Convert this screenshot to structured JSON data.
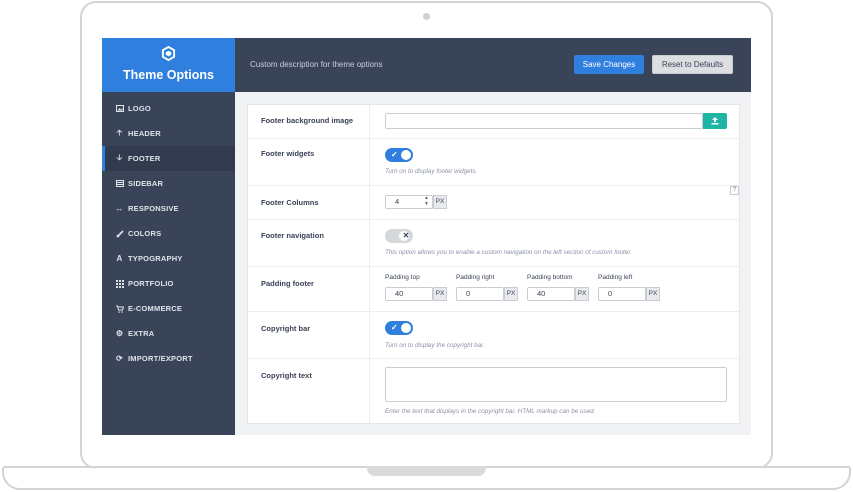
{
  "app": {
    "title": "Theme Options",
    "icon": "hexagon-logo-icon",
    "description": "Custom description for theme options"
  },
  "actions": {
    "save_label": "Save Changes",
    "reset_label": "Reset to Defaults"
  },
  "sidebar": {
    "active": "FOOTER",
    "items": [
      {
        "label": "LOGO",
        "icon": "image-icon"
      },
      {
        "label": "HEADER",
        "icon": "arrow-up-icon"
      },
      {
        "label": "FOOTER",
        "icon": "arrow-down-icon"
      },
      {
        "label": "SIDEBAR",
        "icon": "sidebar-layout-icon"
      },
      {
        "label": "RESPONSIVE",
        "icon": "arrows-horizontal-icon"
      },
      {
        "label": "COLORS",
        "icon": "brush-icon"
      },
      {
        "label": "TYPOGRAPHY",
        "icon": "font-icon"
      },
      {
        "label": "PORTFOLIO",
        "icon": "grid-icon"
      },
      {
        "label": "E-COMMERCE",
        "icon": "cart-icon"
      },
      {
        "label": "EXTRA",
        "icon": "gears-icon"
      },
      {
        "label": "IMPORT/EXPORT",
        "icon": "refresh-icon"
      }
    ]
  },
  "footer_settings": {
    "background_image": {
      "label": "Footer background image",
      "value": "",
      "upload_icon": "upload-icon"
    },
    "widgets": {
      "label": "Footer widgets",
      "enabled": true,
      "description": "Turn on to display footer widgets."
    },
    "columns": {
      "label": "Footer Columns",
      "value": "4",
      "unit": "PX",
      "help": "?"
    },
    "navigation": {
      "label": "Footer navigation",
      "enabled": false,
      "description": "This option allows you to enable a custom navigation on the left section of custom footer."
    },
    "padding": {
      "label": "Padding footer",
      "unit": "PX",
      "fields": [
        {
          "label": "Padding top",
          "value": "40"
        },
        {
          "label": "Padding right",
          "value": "0"
        },
        {
          "label": "Padding bottom",
          "value": "40"
        },
        {
          "label": "Padding left",
          "value": "0"
        }
      ]
    },
    "copyright_bar": {
      "label": "Copyright bar",
      "enabled": true,
      "description": "Turn on to display the copyright bar."
    },
    "copyright_text": {
      "label": "Copyright text",
      "value": "",
      "description": "Enter the text that displays in the copyright bar. HTML markup can be used."
    }
  }
}
